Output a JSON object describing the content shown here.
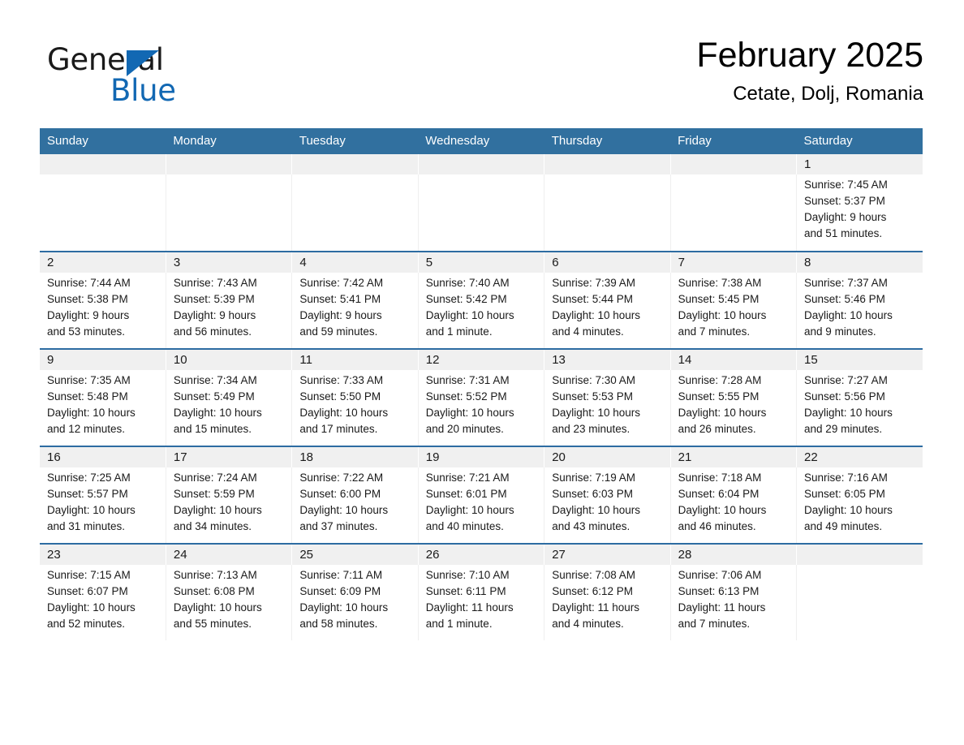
{
  "brand": {
    "name_part1": "General",
    "name_part2": "Blue",
    "triangle_color": "#1268b3"
  },
  "header": {
    "title": "February 2025",
    "subtitle": "Cetate, Dolj, Romania"
  },
  "calendar": {
    "header_color": "#31709f",
    "weekday_headers": [
      "Sunday",
      "Monday",
      "Tuesday",
      "Wednesday",
      "Thursday",
      "Friday",
      "Saturday"
    ],
    "weeks": [
      {
        "days": [
          {
            "date": "",
            "sunrise": "",
            "sunset": "",
            "daylight_line1": "",
            "daylight_line2": ""
          },
          {
            "date": "",
            "sunrise": "",
            "sunset": "",
            "daylight_line1": "",
            "daylight_line2": ""
          },
          {
            "date": "",
            "sunrise": "",
            "sunset": "",
            "daylight_line1": "",
            "daylight_line2": ""
          },
          {
            "date": "",
            "sunrise": "",
            "sunset": "",
            "daylight_line1": "",
            "daylight_line2": ""
          },
          {
            "date": "",
            "sunrise": "",
            "sunset": "",
            "daylight_line1": "",
            "daylight_line2": ""
          },
          {
            "date": "",
            "sunrise": "",
            "sunset": "",
            "daylight_line1": "",
            "daylight_line2": ""
          },
          {
            "date": "1",
            "sunrise": "Sunrise: 7:45 AM",
            "sunset": "Sunset: 5:37 PM",
            "daylight_line1": "Daylight: 9 hours",
            "daylight_line2": "and 51 minutes."
          }
        ]
      },
      {
        "days": [
          {
            "date": "2",
            "sunrise": "Sunrise: 7:44 AM",
            "sunset": "Sunset: 5:38 PM",
            "daylight_line1": "Daylight: 9 hours",
            "daylight_line2": "and 53 minutes."
          },
          {
            "date": "3",
            "sunrise": "Sunrise: 7:43 AM",
            "sunset": "Sunset: 5:39 PM",
            "daylight_line1": "Daylight: 9 hours",
            "daylight_line2": "and 56 minutes."
          },
          {
            "date": "4",
            "sunrise": "Sunrise: 7:42 AM",
            "sunset": "Sunset: 5:41 PM",
            "daylight_line1": "Daylight: 9 hours",
            "daylight_line2": "and 59 minutes."
          },
          {
            "date": "5",
            "sunrise": "Sunrise: 7:40 AM",
            "sunset": "Sunset: 5:42 PM",
            "daylight_line1": "Daylight: 10 hours",
            "daylight_line2": "and 1 minute."
          },
          {
            "date": "6",
            "sunrise": "Sunrise: 7:39 AM",
            "sunset": "Sunset: 5:44 PM",
            "daylight_line1": "Daylight: 10 hours",
            "daylight_line2": "and 4 minutes."
          },
          {
            "date": "7",
            "sunrise": "Sunrise: 7:38 AM",
            "sunset": "Sunset: 5:45 PM",
            "daylight_line1": "Daylight: 10 hours",
            "daylight_line2": "and 7 minutes."
          },
          {
            "date": "8",
            "sunrise": "Sunrise: 7:37 AM",
            "sunset": "Sunset: 5:46 PM",
            "daylight_line1": "Daylight: 10 hours",
            "daylight_line2": "and 9 minutes."
          }
        ]
      },
      {
        "days": [
          {
            "date": "9",
            "sunrise": "Sunrise: 7:35 AM",
            "sunset": "Sunset: 5:48 PM",
            "daylight_line1": "Daylight: 10 hours",
            "daylight_line2": "and 12 minutes."
          },
          {
            "date": "10",
            "sunrise": "Sunrise: 7:34 AM",
            "sunset": "Sunset: 5:49 PM",
            "daylight_line1": "Daylight: 10 hours",
            "daylight_line2": "and 15 minutes."
          },
          {
            "date": "11",
            "sunrise": "Sunrise: 7:33 AM",
            "sunset": "Sunset: 5:50 PM",
            "daylight_line1": "Daylight: 10 hours",
            "daylight_line2": "and 17 minutes."
          },
          {
            "date": "12",
            "sunrise": "Sunrise: 7:31 AM",
            "sunset": "Sunset: 5:52 PM",
            "daylight_line1": "Daylight: 10 hours",
            "daylight_line2": "and 20 minutes."
          },
          {
            "date": "13",
            "sunrise": "Sunrise: 7:30 AM",
            "sunset": "Sunset: 5:53 PM",
            "daylight_line1": "Daylight: 10 hours",
            "daylight_line2": "and 23 minutes."
          },
          {
            "date": "14",
            "sunrise": "Sunrise: 7:28 AM",
            "sunset": "Sunset: 5:55 PM",
            "daylight_line1": "Daylight: 10 hours",
            "daylight_line2": "and 26 minutes."
          },
          {
            "date": "15",
            "sunrise": "Sunrise: 7:27 AM",
            "sunset": "Sunset: 5:56 PM",
            "daylight_line1": "Daylight: 10 hours",
            "daylight_line2": "and 29 minutes."
          }
        ]
      },
      {
        "days": [
          {
            "date": "16",
            "sunrise": "Sunrise: 7:25 AM",
            "sunset": "Sunset: 5:57 PM",
            "daylight_line1": "Daylight: 10 hours",
            "daylight_line2": "and 31 minutes."
          },
          {
            "date": "17",
            "sunrise": "Sunrise: 7:24 AM",
            "sunset": "Sunset: 5:59 PM",
            "daylight_line1": "Daylight: 10 hours",
            "daylight_line2": "and 34 minutes."
          },
          {
            "date": "18",
            "sunrise": "Sunrise: 7:22 AM",
            "sunset": "Sunset: 6:00 PM",
            "daylight_line1": "Daylight: 10 hours",
            "daylight_line2": "and 37 minutes."
          },
          {
            "date": "19",
            "sunrise": "Sunrise: 7:21 AM",
            "sunset": "Sunset: 6:01 PM",
            "daylight_line1": "Daylight: 10 hours",
            "daylight_line2": "and 40 minutes."
          },
          {
            "date": "20",
            "sunrise": "Sunrise: 7:19 AM",
            "sunset": "Sunset: 6:03 PM",
            "daylight_line1": "Daylight: 10 hours",
            "daylight_line2": "and 43 minutes."
          },
          {
            "date": "21",
            "sunrise": "Sunrise: 7:18 AM",
            "sunset": "Sunset: 6:04 PM",
            "daylight_line1": "Daylight: 10 hours",
            "daylight_line2": "and 46 minutes."
          },
          {
            "date": "22",
            "sunrise": "Sunrise: 7:16 AM",
            "sunset": "Sunset: 6:05 PM",
            "daylight_line1": "Daylight: 10 hours",
            "daylight_line2": "and 49 minutes."
          }
        ]
      },
      {
        "days": [
          {
            "date": "23",
            "sunrise": "Sunrise: 7:15 AM",
            "sunset": "Sunset: 6:07 PM",
            "daylight_line1": "Daylight: 10 hours",
            "daylight_line2": "and 52 minutes."
          },
          {
            "date": "24",
            "sunrise": "Sunrise: 7:13 AM",
            "sunset": "Sunset: 6:08 PM",
            "daylight_line1": "Daylight: 10 hours",
            "daylight_line2": "and 55 minutes."
          },
          {
            "date": "25",
            "sunrise": "Sunrise: 7:11 AM",
            "sunset": "Sunset: 6:09 PM",
            "daylight_line1": "Daylight: 10 hours",
            "daylight_line2": "and 58 minutes."
          },
          {
            "date": "26",
            "sunrise": "Sunrise: 7:10 AM",
            "sunset": "Sunset: 6:11 PM",
            "daylight_line1": "Daylight: 11 hours",
            "daylight_line2": "and 1 minute."
          },
          {
            "date": "27",
            "sunrise": "Sunrise: 7:08 AM",
            "sunset": "Sunset: 6:12 PM",
            "daylight_line1": "Daylight: 11 hours",
            "daylight_line2": "and 4 minutes."
          },
          {
            "date": "28",
            "sunrise": "Sunrise: 7:06 AM",
            "sunset": "Sunset: 6:13 PM",
            "daylight_line1": "Daylight: 11 hours",
            "daylight_line2": "and 7 minutes."
          },
          {
            "date": "",
            "sunrise": "",
            "sunset": "",
            "daylight_line1": "",
            "daylight_line2": ""
          }
        ]
      }
    ]
  }
}
